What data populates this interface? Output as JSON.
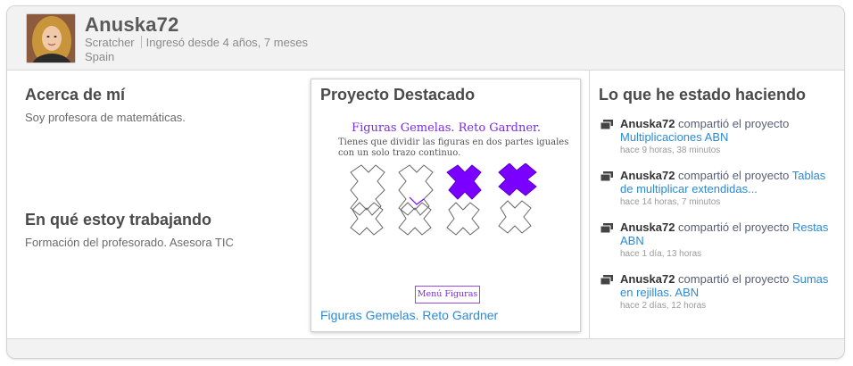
{
  "profile": {
    "username": "Anuska72",
    "role": "Scratcher",
    "joined": "Ingresó desde 4 años, 7 meses",
    "location": "Spain"
  },
  "about": {
    "title": "Acerca de mí",
    "text": "Soy profesora de matemáticas."
  },
  "working_on": {
    "title": "En qué estoy trabajando",
    "text": "Formación del profesorado. Asesora TIC"
  },
  "featured": {
    "title": "Proyecto Destacado",
    "thumb_title": "Figuras Gemelas. Reto Gardner.",
    "thumb_line1": "Tienes que dividir las figuras en dos partes iguales",
    "thumb_line2": "con un solo trazo continuo.",
    "thumb_button": "Menú Figuras",
    "project_link": "Figuras Gemelas. Reto Gardner",
    "colors": {
      "accent": "#7a2be0",
      "link": "#2c8ad6",
      "shape_fill": "#7a00ff"
    }
  },
  "activity": {
    "title": "Lo que he estado haciendo",
    "verb": "compartió el proyecto",
    "items": [
      {
        "user": "Anuska72",
        "action": "compartió el proyecto",
        "project": "Multiplicaciones ABN",
        "time": "hace 9 horas, 38 minutos"
      },
      {
        "user": "Anuska72",
        "action": "compartió el proyecto",
        "project": "Tablas de multiplicar extendidas...",
        "time": "hace 14 horas, 7 minutos"
      },
      {
        "user": "Anuska72",
        "action": "compartió el proyecto",
        "project": "Restas ABN",
        "time": "hace 1 día, 13 horas"
      },
      {
        "user": "Anuska72",
        "action": "compartió el proyecto",
        "project": "Sumas en rejillas. ABN",
        "time": "hace 2 días, 12 horas"
      }
    ]
  }
}
